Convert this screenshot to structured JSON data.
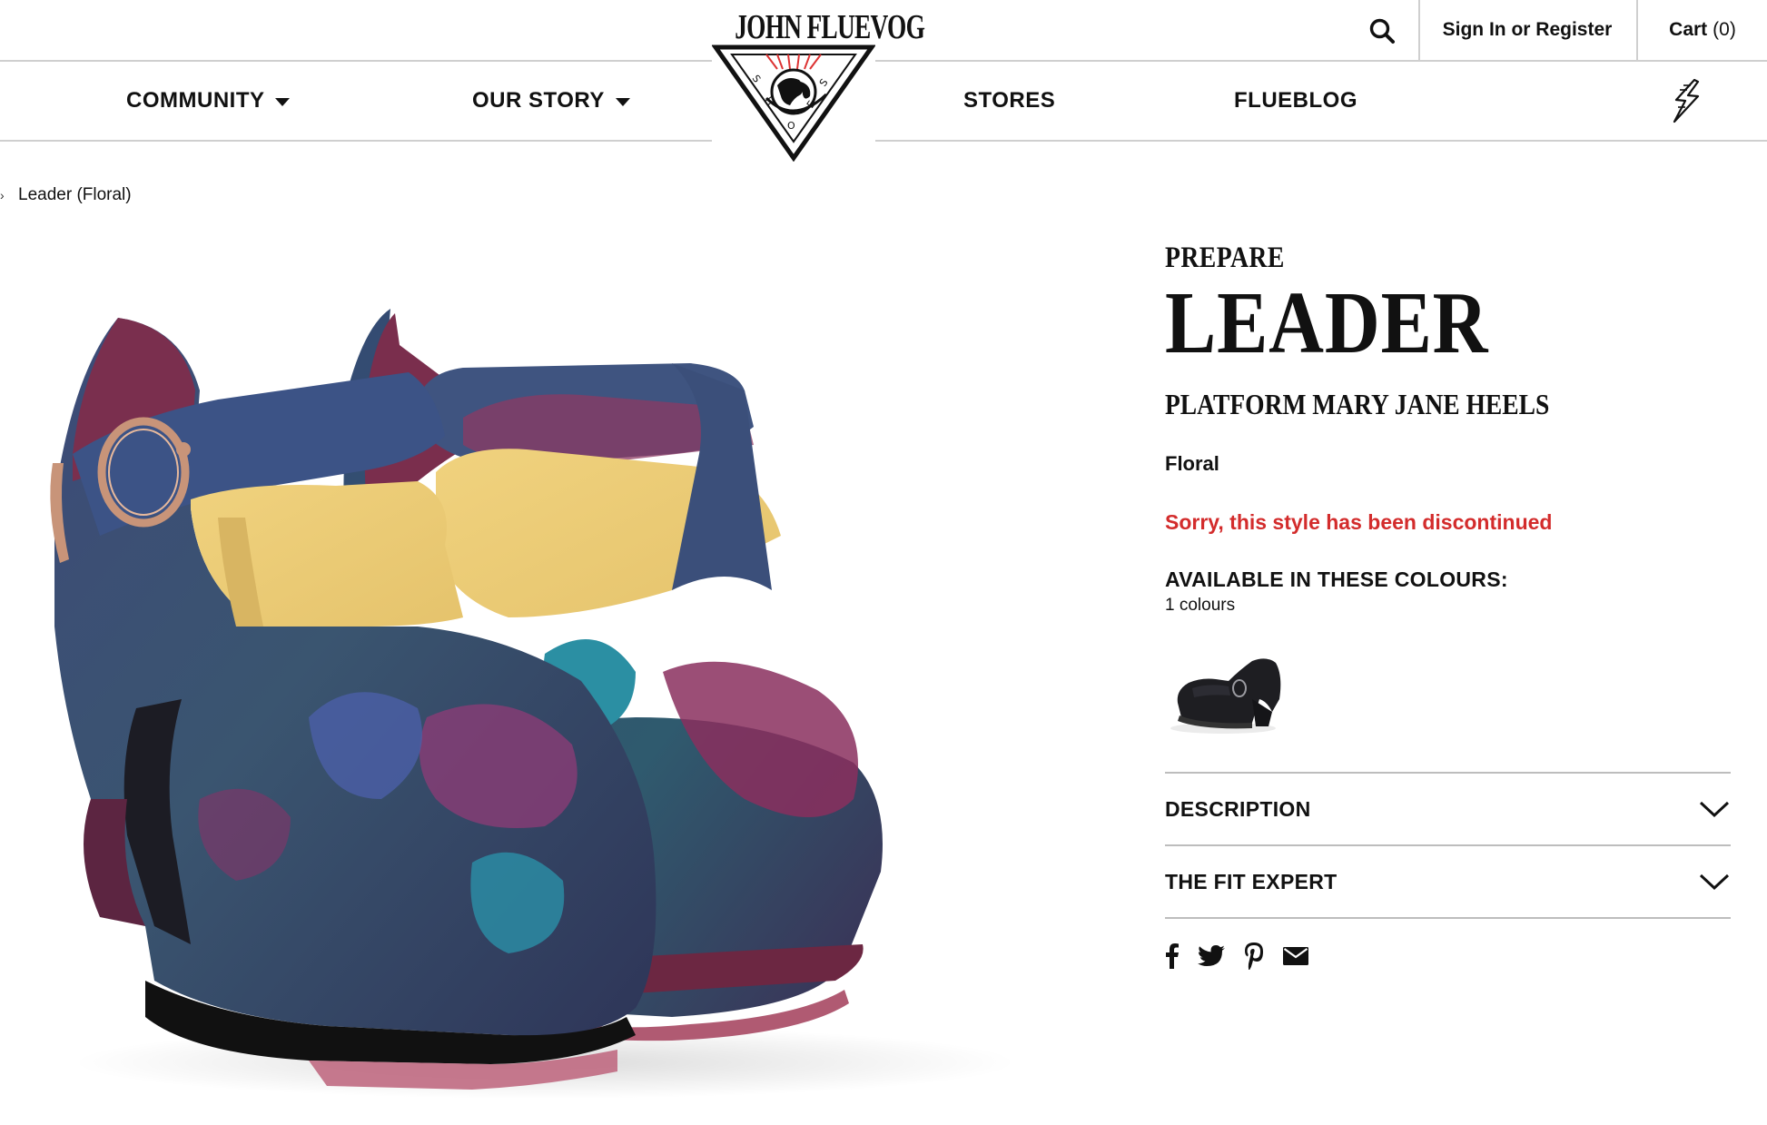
{
  "brand": {
    "logo_text": "JOHN FLUEVOG",
    "logo_subtext": "SHOES",
    "logo_mark": "globe-triangle-logo"
  },
  "topbar": {
    "search_icon": "search-icon",
    "signin_label": "Sign In or Register",
    "cart_label": "Cart",
    "cart_count": "(0)"
  },
  "nav": {
    "items": [
      {
        "label": "COMMUNITY",
        "has_dropdown": true
      },
      {
        "label": "OUR STORY",
        "has_dropdown": true
      },
      {
        "label": "STORES",
        "has_dropdown": false
      },
      {
        "label": "FLUEBLOG",
        "has_dropdown": false
      }
    ],
    "bolt_icon": "lightning-bolt-icon"
  },
  "breadcrumb": {
    "items": [
      "Leader (Floral)"
    ]
  },
  "product": {
    "collection": "PREPARE",
    "name": "LEADER",
    "subtitle": "PLATFORM MARY JANE HEELS",
    "colour": "Floral",
    "status": "Sorry, this style has been discontinued",
    "colours_title": "AVAILABLE IN THESE COLOURS:",
    "colours_count": "1 colours",
    "image": "floral-mary-jane-platform-heels-photo"
  },
  "accordions": [
    {
      "label": "DESCRIPTION",
      "icon": "chevron-down-icon"
    },
    {
      "label": "THE FIT EXPERT",
      "icon": "chevron-down-icon"
    }
  ],
  "share": {
    "icons": [
      "facebook-icon",
      "twitter-icon",
      "pinterest-icon",
      "email-icon"
    ]
  },
  "colors": {
    "text": "#111111",
    "accent_red": "#d32c2c",
    "divider": "#cfcfcf"
  }
}
